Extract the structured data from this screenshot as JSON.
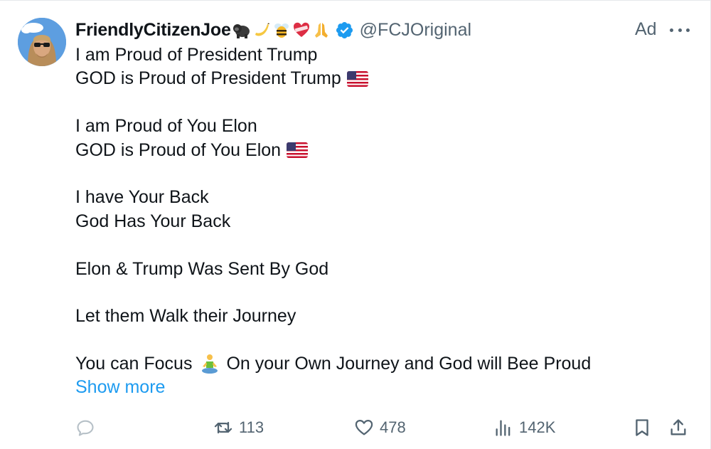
{
  "author": {
    "display_name": "FriendlyCitizenJoe",
    "name_emojis": [
      "gorilla-emoji",
      "banana-emoji",
      "bee-emoji",
      "mending-heart-emoji",
      "folded-hands-emoji"
    ],
    "verified": true,
    "handle": "@FCJOriginal"
  },
  "promo_label": "Ad",
  "body": {
    "lines": [
      "I am Proud of President Trump",
      "GOD is Proud of President Trump",
      "",
      "I am Proud of You Elon",
      "GOD is Proud of You Elon",
      "",
      "I have Your Back",
      "God Has Your Back",
      "",
      "Elon & Trump Was Sent By God",
      "",
      "Let them Walk their Journey",
      "",
      "You can Focus",
      "On your Own Journey and God will Bee Proud"
    ],
    "show_more": "Show more"
  },
  "metrics": {
    "reply_count": "",
    "retweet_count": "113",
    "like_count": "478",
    "view_count": "142K"
  },
  "colors": {
    "text": "#0f1419",
    "secondary": "#536471",
    "link": "#1d9bf0",
    "verified": "#1d9bf0"
  }
}
